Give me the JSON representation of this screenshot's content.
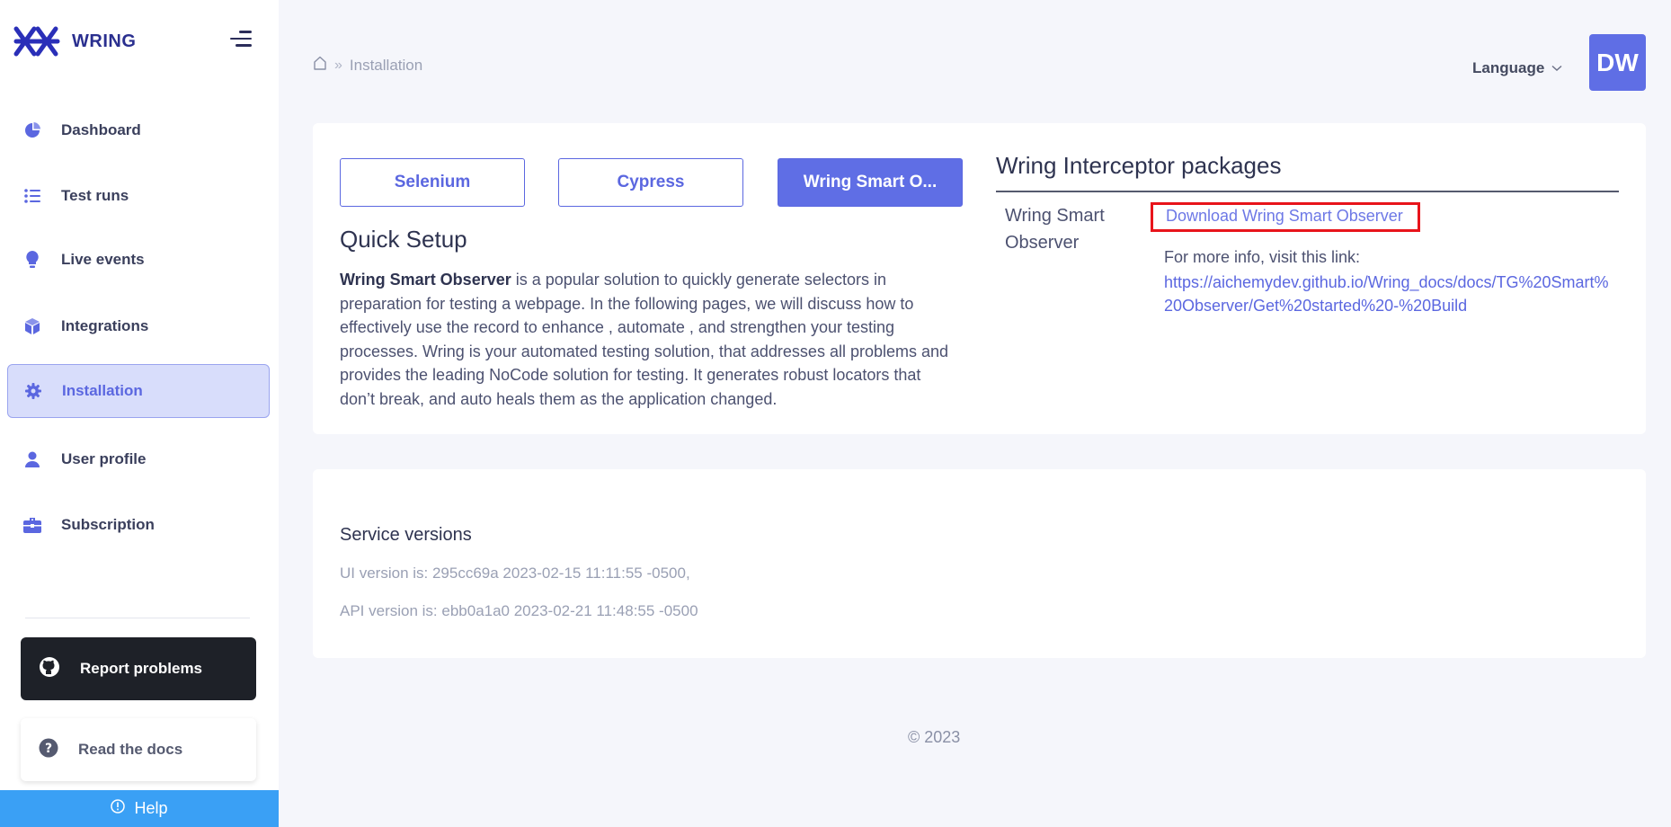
{
  "brand": {
    "name": "WRING"
  },
  "sidebar": {
    "items": [
      {
        "label": "Dashboard",
        "icon": "pie-chart-icon"
      },
      {
        "label": "Test runs",
        "icon": "list-icon"
      },
      {
        "label": "Live events",
        "icon": "lightbulb-icon"
      },
      {
        "label": "Integrations",
        "icon": "cube-icon"
      },
      {
        "label": "Installation",
        "icon": "gear-icon",
        "active": true
      },
      {
        "label": "User profile",
        "icon": "user-icon"
      },
      {
        "label": "Subscription",
        "icon": "briefcase-icon"
      }
    ],
    "report_label": "Report problems",
    "docs_label": "Read the docs",
    "help_label": "Help"
  },
  "header": {
    "breadcrumb_current": "Installation",
    "language_label": "Language",
    "avatar_initials": "DW"
  },
  "install": {
    "tabs": [
      {
        "label": "Selenium"
      },
      {
        "label": "Cypress"
      },
      {
        "label": "Wring Smart O..."
      }
    ],
    "quick_setup_title": "Quick Setup",
    "description_bold": "Wring Smart Observer",
    "description_rest": " is a popular solution to quickly generate selectors in preparation for testing a webpage. In the following pages, we will discuss how to effectively use the record to enhance , automate , and strengthen your testing processes. Wring is your automated testing solution, that addresses all problems and provides the leading NoCode solution for testing. It generates robust locators that don’t break, and auto heals them as the application changed.",
    "packages_title": "Wring Interceptor packages",
    "package_name": "Wring Smart Observer",
    "download_label": "Download Wring Smart Observer",
    "more_info_label": "For more info, visit this link:",
    "more_info_link": "https://aichemydev.github.io/Wring_docs/docs/TG%20Smart%20Observer/Get%20started%20-%20Build"
  },
  "services": {
    "title": "Service versions",
    "ui_version": "UI version is: 295cc69a 2023-02-15 11:11:55 -0500,",
    "api_version": "API version is: ebb0a1a0 2023-02-21 11:48:55 -0500"
  },
  "footer": {
    "copyright": "© 2023"
  },
  "colors": {
    "accent": "#5f6ee5",
    "highlight_border": "#e8141b",
    "help": "#3aa0f5"
  }
}
